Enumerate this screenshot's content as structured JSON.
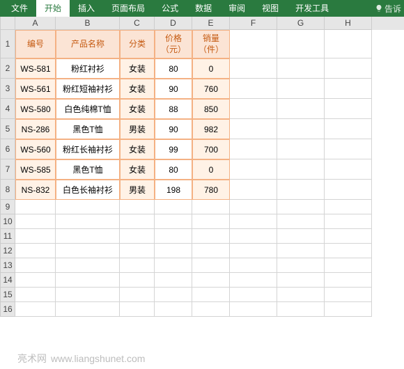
{
  "ribbon": {
    "tabs": [
      "文件",
      "开始",
      "插入",
      "页面布局",
      "公式",
      "数据",
      "审阅",
      "视图",
      "开发工具"
    ],
    "tell": "告诉"
  },
  "columns": [
    {
      "letter": "A",
      "w": 58
    },
    {
      "letter": "B",
      "w": 92
    },
    {
      "letter": "C",
      "w": 50
    },
    {
      "letter": "D",
      "w": 54
    },
    {
      "letter": "E",
      "w": 54
    },
    {
      "letter": "F",
      "w": 68
    },
    {
      "letter": "G",
      "w": 68
    },
    {
      "letter": "H",
      "w": 68
    }
  ],
  "headerRowHeight": 41,
  "dataRowHeight": 29,
  "emptyRowHeight": 21,
  "rowCount": 16,
  "headers": [
    "编号",
    "产品名称",
    "分类",
    "价格\n（元）",
    "销量\n（件）"
  ],
  "data": [
    [
      "WS-581",
      "粉红衬衫",
      "女装",
      "80",
      "0"
    ],
    [
      "WS-561",
      "粉红短袖衬衫",
      "女装",
      "90",
      "760"
    ],
    [
      "WS-580",
      "白色纯棉T恤",
      "女装",
      "88",
      "850"
    ],
    [
      "NS-286",
      "黑色T恤",
      "男装",
      "90",
      "982"
    ],
    [
      "WS-560",
      "粉红长袖衬衫",
      "女装",
      "99",
      "700"
    ],
    [
      "WS-585",
      "黑色T恤",
      "女装",
      "80",
      "0"
    ],
    [
      "NS-832",
      "白色长袖衬衫",
      "男装",
      "198",
      "780"
    ]
  ],
  "altCols": [
    0,
    2,
    4
  ],
  "watermark": {
    "cn": "亮术网",
    "en": "www.liangshunet.com"
  },
  "chart_data": {
    "type": "table",
    "title": "",
    "columns": [
      "编号",
      "产品名称",
      "分类",
      "价格（元）",
      "销量（件）"
    ],
    "rows": [
      {
        "编号": "WS-581",
        "产品名称": "粉红衬衫",
        "分类": "女装",
        "价格（元）": 80,
        "销量（件）": 0
      },
      {
        "编号": "WS-561",
        "产品名称": "粉红短袖衬衫",
        "分类": "女装",
        "价格（元）": 90,
        "销量（件）": 760
      },
      {
        "编号": "WS-580",
        "产品名称": "白色纯棉T恤",
        "分类": "女装",
        "价格（元）": 88,
        "销量（件）": 850
      },
      {
        "编号": "NS-286",
        "产品名称": "黑色T恤",
        "分类": "男装",
        "价格（元）": 90,
        "销量（件）": 982
      },
      {
        "编号": "WS-560",
        "产品名称": "粉红长袖衬衫",
        "分类": "女装",
        "价格（元）": 99,
        "销量（件）": 700
      },
      {
        "编号": "WS-585",
        "产品名称": "黑色T恤",
        "分类": "女装",
        "价格（元）": 80,
        "销量（件）": 0
      },
      {
        "编号": "NS-832",
        "产品名称": "白色长袖衬衫",
        "分类": "男装",
        "价格（元）": 198,
        "销量（件）": 780
      }
    ]
  }
}
